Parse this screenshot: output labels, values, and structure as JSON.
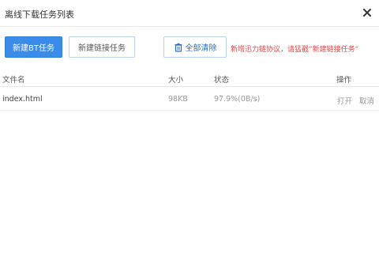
{
  "dialog": {
    "title": "离线下载任务列表",
    "close_icon": "close-icon"
  },
  "toolbar": {
    "new_bt_label": "新建BT任务",
    "new_link_label": "新建链接任务",
    "clear_all_label": "全部清除",
    "clear_icon": "trash-icon",
    "hint": "新增迅力链协议，请猛戳“新建链接任务”"
  },
  "table": {
    "headers": {
      "name": "文件名",
      "size": "大小",
      "status": "状态",
      "actions": "操作"
    },
    "rows": [
      {
        "name": "index.html",
        "size": "98KB",
        "status": "97.9%(0B/s)",
        "open": "打开",
        "cancel": "取消"
      }
    ]
  },
  "colors": {
    "primary": "#3b8ce8",
    "hint": "#e24b4b",
    "border": "#bcd2ef"
  }
}
